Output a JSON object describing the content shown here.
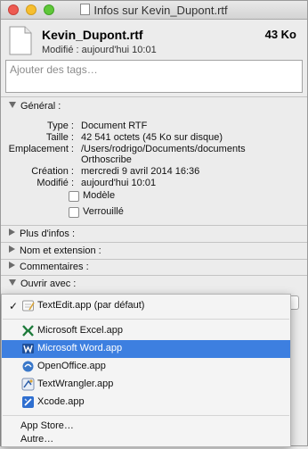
{
  "window": {
    "title": "Infos sur Kevin_Dupont.rtf"
  },
  "header": {
    "file_name": "Kevin_Dupont.rtf",
    "file_size": "43 Ko",
    "modified": "Modifié : aujourd'hui 10:01"
  },
  "tags": {
    "placeholder": "Ajouter des tags…"
  },
  "general": {
    "title": "Général :",
    "rows": [
      {
        "label": "Type :",
        "value": "Document RTF"
      },
      {
        "label": "Taille :",
        "value": "42 541 octets (45 Ko sur disque)"
      },
      {
        "label": "Emplacement :",
        "value": "/Users/rodrigo/Documents/documents"
      },
      {
        "label": "",
        "value": "Orthoscribe"
      },
      {
        "label": "Création :",
        "value": "mercredi 9 avril 2014 16:36"
      },
      {
        "label": "Modifié :",
        "value": "aujourd'hui 10:01"
      }
    ],
    "checkboxes": [
      {
        "label": "Modèle",
        "checked": false
      },
      {
        "label": "Verrouillé",
        "checked": false
      }
    ]
  },
  "sections": {
    "more_info": "Plus d'infos :",
    "name_ext": "Nom et extension :",
    "comments": "Commentaires :",
    "open_with": "Ouvrir avec :"
  },
  "menu": {
    "default_app": "TextEdit.app (par défaut)",
    "apps": [
      {
        "name": "Microsoft Excel.app",
        "icon": "excel-icon"
      },
      {
        "name": "Microsoft Word.app",
        "icon": "word-icon",
        "selected": true
      },
      {
        "name": "OpenOffice.app",
        "icon": "openoffice-icon"
      },
      {
        "name": "TextWrangler.app",
        "icon": "textwrangler-icon"
      },
      {
        "name": "Xcode.app",
        "icon": "xcode-icon"
      }
    ],
    "app_store": "App Store…",
    "other": "Autre…"
  },
  "colors": {
    "selection": "#3d7fe0",
    "close": "#ee5b52",
    "minimize": "#f6be2e",
    "zoom": "#5fc739"
  }
}
